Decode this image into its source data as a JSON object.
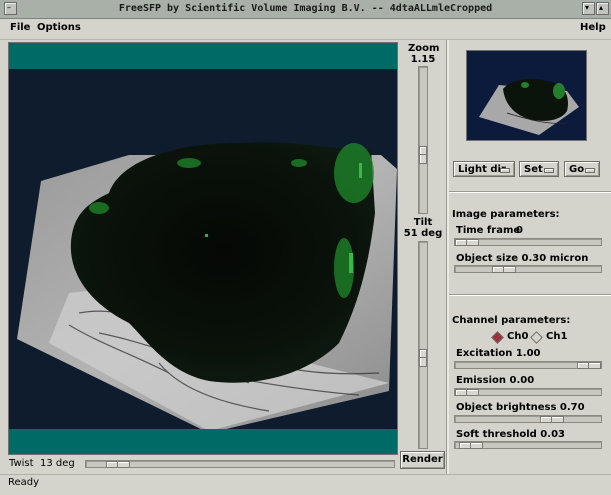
{
  "window": {
    "title": "FreeSFP by Scientific Volume Imaging B.V. -- 4dtaALLmleCropped"
  },
  "menubar": {
    "file": "File",
    "options": "Options",
    "help": "Help"
  },
  "zoom": {
    "label": "Zoom",
    "value": "1.15",
    "level": 0.62
  },
  "tilt": {
    "label": "Tilt",
    "value": "51 deg",
    "level": 0.57
  },
  "twist": {
    "label": "Twist",
    "value": "13 deg",
    "level": 0.07
  },
  "render_button": "Render",
  "status": "Ready",
  "right_panel": {
    "light_dir": "Light dir.",
    "set": "Set",
    "go": "Go",
    "image_params_title": "Image parameters:",
    "time_frame": "Time frame",
    "time_frame_value": "0",
    "time_frame_level": 0.0,
    "object_size": "Object size 0.30 micron",
    "object_size_level": 0.3,
    "channel_params_title": "Channel parameters:",
    "ch0": "Ch0",
    "ch1": "Ch1",
    "selected_channel": "Ch0",
    "excitation": "Excitation 1.00",
    "excitation_level": 1.0,
    "emission": "Emission 0.00",
    "emission_level": 0.0,
    "object_brightness": "Object brightness 0.70",
    "object_brightness_level": 0.7,
    "soft_threshold": "Soft threshold 0.03",
    "soft_threshold_level": 0.03
  },
  "colors": {
    "teal_band": "#006a66",
    "background": "#0e1c2e",
    "selected_radio": "#a0303a"
  }
}
